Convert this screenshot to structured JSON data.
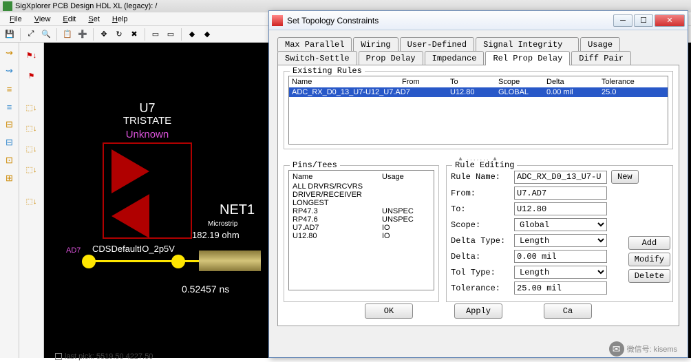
{
  "main": {
    "title": "SigXplorer PCB Design HDL XL (legacy): /",
    "menu": {
      "file": "File",
      "view": "View",
      "edit": "Edit",
      "set": "Set",
      "help": "Help"
    }
  },
  "canvas": {
    "refdes": "U7",
    "type": "TRISTATE",
    "model": "Unknown",
    "net": "NET1",
    "tline_type": "Microstrip",
    "impedance": "182.19 ohm",
    "pin": "AD7",
    "iomodel": "CDSDefaultIO_2p5V",
    "delay": "0.52457 ns"
  },
  "dialog": {
    "title": "Set Topology Constraints",
    "tabs_row1": [
      "Max Parallel",
      "Wiring",
      "User-Defined",
      "Signal Integrity",
      "Usage"
    ],
    "tabs_row2": [
      "Switch-Settle",
      "Prop Delay",
      "Impedance",
      "Rel Prop Delay",
      "Diff Pair"
    ],
    "active_tab": "Rel Prop Delay",
    "existing_rules": {
      "legend": "Existing Rules",
      "headers": [
        "Name",
        "From",
        "To",
        "Scope",
        "Delta",
        "Tolerance"
      ],
      "rows": [
        {
          "name": "ADC_RX_D0_13_U7-U12_U7.AD7",
          "from": "",
          "to": "U12.80",
          "scope": "GLOBAL",
          "delta": "0.00 mil",
          "tolerance": "25.0"
        }
      ]
    },
    "pins_tees": {
      "legend": "Pins/Tees",
      "headers": [
        "Name",
        "Usage"
      ],
      "rows": [
        {
          "name": "ALL DRVRS/RCVRS",
          "usage": ""
        },
        {
          "name": "DRIVER/RECEIVER",
          "usage": ""
        },
        {
          "name": "LONGEST",
          "usage": ""
        },
        {
          "name": "RP47.3",
          "usage": "UNSPEC"
        },
        {
          "name": "RP47.6",
          "usage": "UNSPEC"
        },
        {
          "name": "U7.AD7",
          "usage": "IO"
        },
        {
          "name": "U12.80",
          "usage": "IO"
        }
      ]
    },
    "rule_editing": {
      "legend": "Rule Editing",
      "rule_name_label": "Rule Name:",
      "rule_name": "ADC_RX_D0_13_U7-U",
      "from_label": "From:",
      "from": "U7.AD7",
      "to_label": "To:",
      "to": "U12.80",
      "scope_label": "Scope:",
      "scope": "Global",
      "delta_type_label": "Delta Type:",
      "delta_type": "Length",
      "delta_label": "Delta:",
      "delta": "0.00 mil",
      "tol_type_label": "Tol Type:",
      "tol_type": "Length",
      "tolerance_label": "Tolerance:",
      "tolerance": "25.00 mil"
    },
    "buttons": {
      "new": "New",
      "add": "Add",
      "modify": "Modify",
      "delete": "Delete",
      "ok": "OK",
      "apply": "Apply",
      "cancel": "Ca"
    }
  },
  "status": {
    "lastpick": "last pick: 5519.50 4227.50"
  },
  "watermark": "微信号: kisems"
}
